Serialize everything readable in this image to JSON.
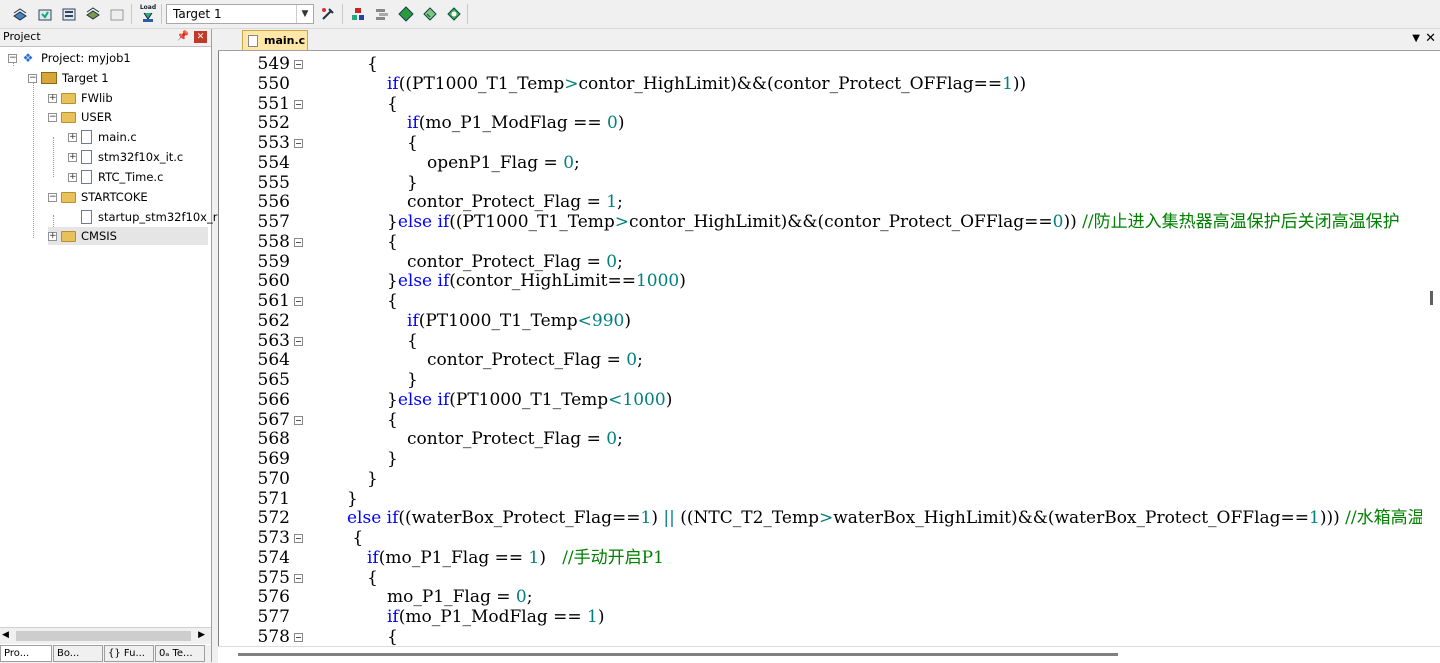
{
  "toolbar": {
    "target_select": "Target 1",
    "load_label": "Load"
  },
  "project_pane": {
    "title": "Project",
    "tree": [
      {
        "label": "Project: myjob1"
      },
      {
        "label": "Target 1"
      },
      {
        "label": "FWlib"
      },
      {
        "label": "USER"
      },
      {
        "label": "main.c"
      },
      {
        "label": "stm32f10x_it.c"
      },
      {
        "label": "RTC_Time.c"
      },
      {
        "label": "STARTCOKE"
      },
      {
        "label": "startup_stm32f10x_r"
      },
      {
        "label": "CMSIS"
      }
    ],
    "bottom_tabs": [
      "Pro...",
      "Bo...",
      "{} Fu...",
      "0ₐ Te..."
    ]
  },
  "editor": {
    "tab_label": "main.c",
    "lines": [
      {
        "n": "549",
        "fold": true,
        "ind": 3,
        "h": "{"
      },
      {
        "n": "550",
        "fold": false,
        "ind": 4,
        "h": "<span class=\"kw\">if</span>((PT1000_T1_Temp<span class=\"op\">&gt;</span>contor_HighLimit)&amp;&amp;(contor_Protect_OFFlag==<span class=\"num\">1</span>))"
      },
      {
        "n": "551",
        "fold": true,
        "ind": 4,
        "h": "{"
      },
      {
        "n": "552",
        "fold": false,
        "ind": 5,
        "h": "<span class=\"kw\">if</span>(mo_P1_ModFlag == <span class=\"num\">0</span>)"
      },
      {
        "n": "553",
        "fold": true,
        "ind": 5,
        "h": "{"
      },
      {
        "n": "554",
        "fold": false,
        "ind": 6,
        "h": "openP1_Flag = <span class=\"num\">0</span>;"
      },
      {
        "n": "555",
        "fold": false,
        "ind": 5,
        "h": "}"
      },
      {
        "n": "556",
        "fold": false,
        "ind": 5,
        "h": "contor_Protect_Flag = <span class=\"num\">1</span>;"
      },
      {
        "n": "557",
        "fold": false,
        "ind": 4,
        "h": "}<span class=\"kw\">else if</span>((PT1000_T1_Temp<span class=\"op\">&gt;</span>contor_HighLimit)&amp;&amp;(contor_Protect_OFFlag==<span class=\"num\">0</span>)) <span class=\"cm\">//防止进入集热器高温保护后关闭高温保护</span>"
      },
      {
        "n": "558",
        "fold": true,
        "ind": 4,
        "h": "{"
      },
      {
        "n": "559",
        "fold": false,
        "ind": 5,
        "h": "contor_Protect_Flag = <span class=\"num\">0</span>;"
      },
      {
        "n": "560",
        "fold": false,
        "ind": 4,
        "h": "}<span class=\"kw\">else if</span>(contor_HighLimit==<span class=\"num\">1000</span>)"
      },
      {
        "n": "561",
        "fold": true,
        "ind": 4,
        "h": "{"
      },
      {
        "n": "562",
        "fold": false,
        "ind": 5,
        "h": "<span class=\"kw\">if</span>(PT1000_T1_Temp<span class=\"op\">&lt;</span><span class=\"num\">990</span>)"
      },
      {
        "n": "563",
        "fold": true,
        "ind": 5,
        "h": "{"
      },
      {
        "n": "564",
        "fold": false,
        "ind": 6,
        "h": "contor_Protect_Flag = <span class=\"num\">0</span>;"
      },
      {
        "n": "565",
        "fold": false,
        "ind": 5,
        "h": "}"
      },
      {
        "n": "566",
        "fold": false,
        "ind": 4,
        "h": "}<span class=\"kw\">else if</span>(PT1000_T1_Temp<span class=\"op\">&lt;</span><span class=\"num\">1000</span>)"
      },
      {
        "n": "567",
        "fold": true,
        "ind": 4,
        "h": "{"
      },
      {
        "n": "568",
        "fold": false,
        "ind": 5,
        "h": "contor_Protect_Flag = <span class=\"num\">0</span>;"
      },
      {
        "n": "569",
        "fold": false,
        "ind": 4,
        "h": "}"
      },
      {
        "n": "570",
        "fold": false,
        "ind": 3,
        "h": "}"
      },
      {
        "n": "571",
        "fold": false,
        "ind": 2,
        "h": "}"
      },
      {
        "n": "572",
        "fold": false,
        "ind": 2,
        "h": "<span class=\"kw\">else if</span>((waterBox_Protect_Flag==<span class=\"num\">1</span>) <span class=\"op\">||</span> ((NTC_T2_Temp<span class=\"op\">&gt;</span>waterBox_HighLimit)&amp;&amp;(waterBox_Protect_OFFlag==<span class=\"num\">1</span>))) <span class=\"cm\">//水箱高温保护</span>"
      },
      {
        "n": "573",
        "fold": true,
        "ind": 2,
        "h": " {"
      },
      {
        "n": "574",
        "fold": false,
        "ind": 3,
        "h": "<span class=\"kw\">if</span>(mo_P1_Flag == <span class=\"num\">1</span>)   <span class=\"cm\">//手动开启P1</span>"
      },
      {
        "n": "575",
        "fold": true,
        "ind": 3,
        "h": "{"
      },
      {
        "n": "576",
        "fold": false,
        "ind": 4,
        "h": "mo_P1_Flag = <span class=\"num\">0</span>;"
      },
      {
        "n": "577",
        "fold": false,
        "ind": 4,
        "h": "<span class=\"kw\">if</span>(mo_P1_ModFlag == <span class=\"num\">1</span>)"
      },
      {
        "n": "578",
        "fold": true,
        "ind": 4,
        "h": "{"
      }
    ]
  }
}
